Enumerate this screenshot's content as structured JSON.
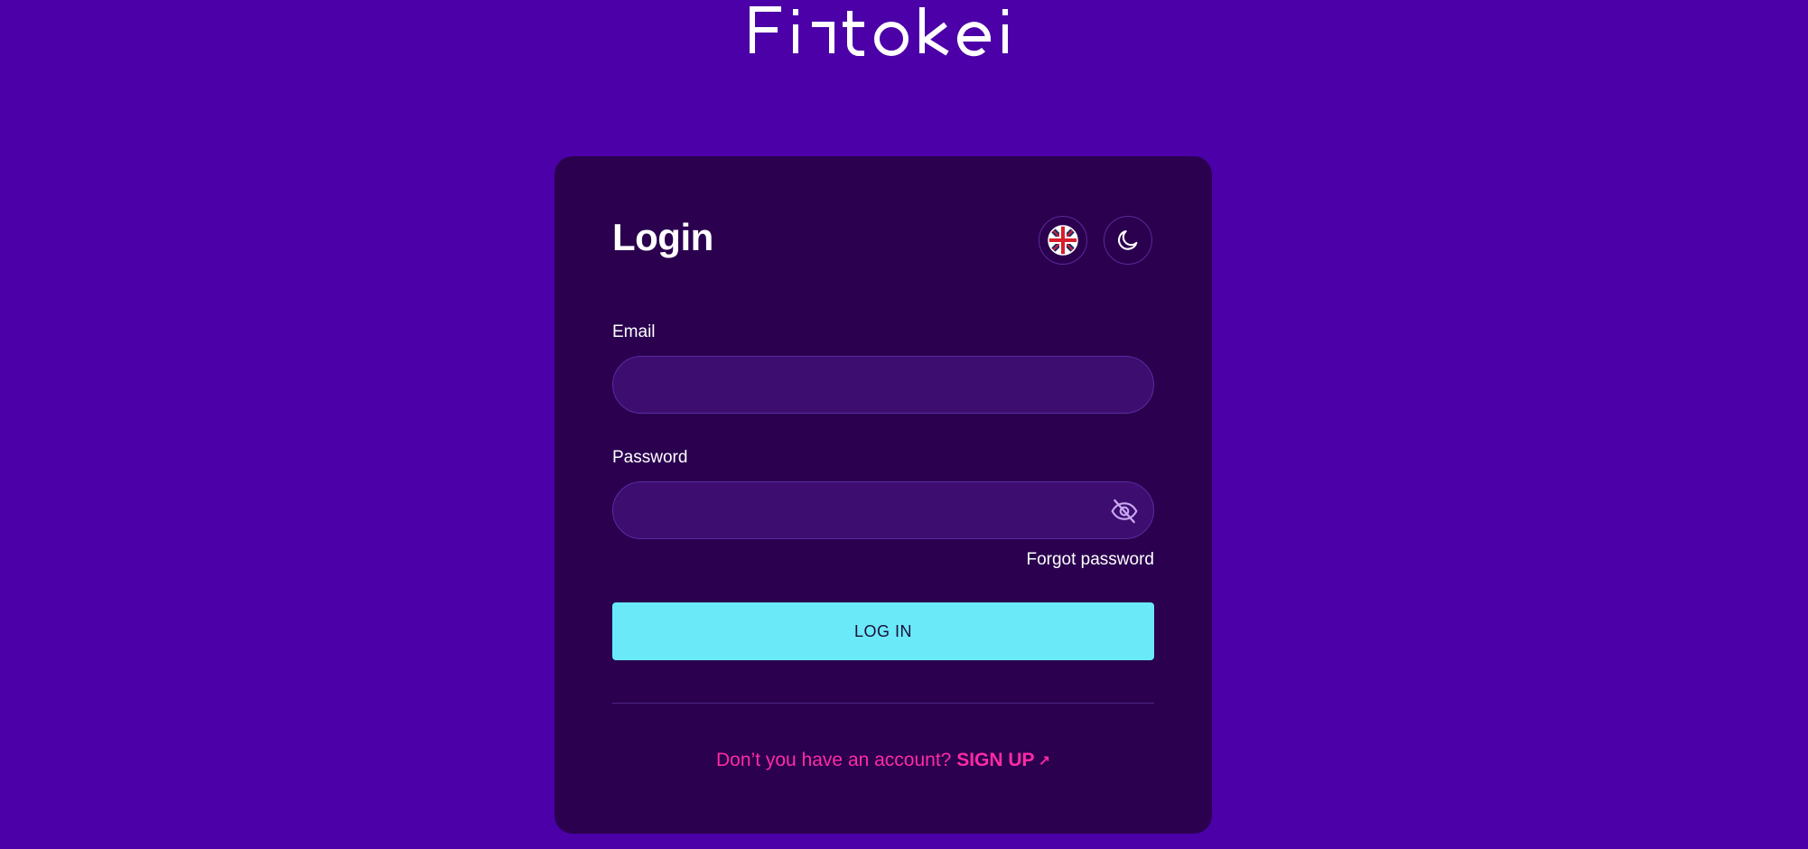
{
  "brand": {
    "logo_text": "Fintokei",
    "background_color": "#4c01a8",
    "card_color": "#2a004f",
    "accent_color": "#6aeaf8",
    "link_color": "#ff2aa4"
  },
  "login_card": {
    "title": "Login",
    "language_button": {
      "icon": "uk-flag-icon"
    },
    "theme_button": {
      "icon": "moon-icon"
    },
    "email": {
      "label": "Email",
      "value": "",
      "placeholder": ""
    },
    "password": {
      "label": "Password",
      "value": "",
      "placeholder": "",
      "toggle_icon": "eye-off-icon"
    },
    "forgot_password_label": "Forgot password",
    "login_button_label": "LOG IN",
    "signup_prompt": "Don’t you have an account?",
    "signup_link_label": "SIGN UP",
    "signup_arrow_icon": "arrow-up-right-icon"
  }
}
